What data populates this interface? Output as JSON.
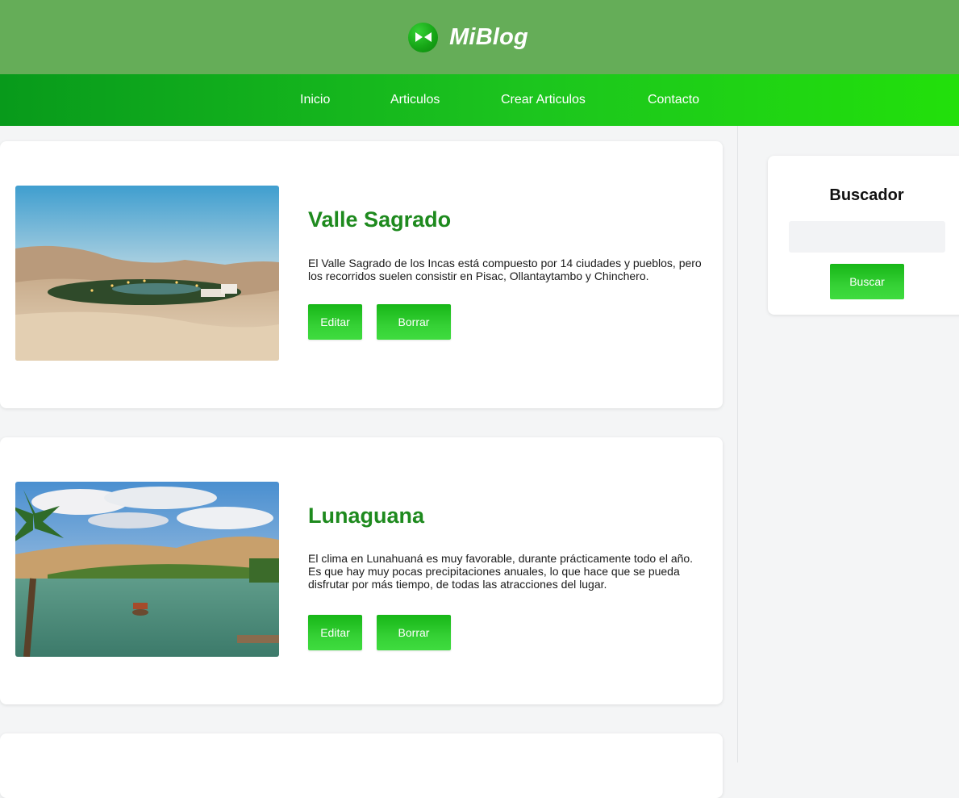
{
  "site": {
    "title": "MiBlog",
    "brand_color": "#65ad58"
  },
  "nav": {
    "items": [
      {
        "label": "Inicio"
      },
      {
        "label": "Articulos"
      },
      {
        "label": "Crear Articulos"
      },
      {
        "label": "Contacto"
      }
    ]
  },
  "articles": [
    {
      "title": "Valle Sagrado",
      "description": "El Valle Sagrado de los Incas está compuesto por 14 ciudades y pueblos, pero los recorridos suelen consistir en Pisac, Ollantaytambo y Chinchero.",
      "edit_label": "Editar",
      "delete_label": "Borrar"
    },
    {
      "title": "Lunaguana",
      "description": "El clima en Lunahuaná es muy favorable, durante prácticamente todo el año. Es que hay muy pocas precipitaciones anuales, lo que hace que se pueda disfrutar por más tiempo, de todas las atracciones del lugar.",
      "edit_label": "Editar",
      "delete_label": "Borrar"
    }
  ],
  "sidebar": {
    "title": "Buscador",
    "search_value": "",
    "search_button": "Buscar"
  },
  "colors": {
    "accent": "#1e8a1e",
    "button": "#2ec92e",
    "nav_start": "#089a1b",
    "nav_end": "#22e00b"
  }
}
